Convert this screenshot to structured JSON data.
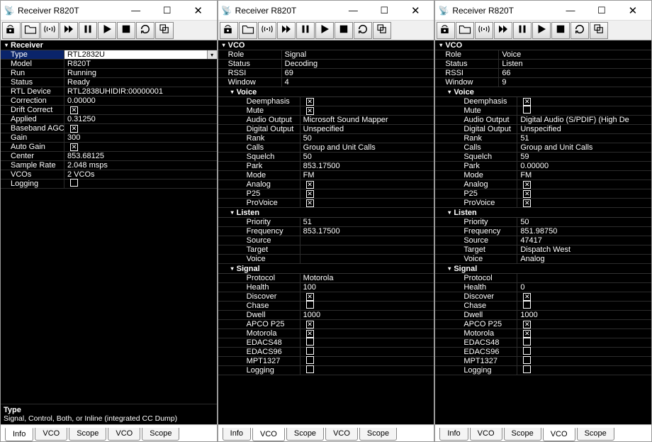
{
  "common": {
    "window_title": "Receiver R820T",
    "toolbar_icons": [
      "device",
      "open",
      "broadcast",
      "fast-forward",
      "pause",
      "play",
      "stop",
      "loop",
      "copy"
    ],
    "tabs": [
      "Info",
      "VCO",
      "Scope",
      "VCO",
      "Scope"
    ]
  },
  "win1": {
    "active_tab": 0,
    "sections": {
      "Receiver": {
        "rows": [
          {
            "label": "Type",
            "value": "RTL2832U",
            "selected": true,
            "dropdown": true
          },
          {
            "label": "Model",
            "value": "R820T"
          },
          {
            "label": "Run",
            "value": "Running"
          },
          {
            "label": "Status",
            "value": "Ready"
          },
          {
            "label": "RTL Device",
            "value": "RTL2838UHIDIR:00000001"
          },
          {
            "label": "Correction",
            "value": "0.00000"
          },
          {
            "label": "Drift Correct",
            "checkbox": true,
            "checked": true
          },
          {
            "label": "Applied",
            "value": "0.31250"
          },
          {
            "label": "Baseband AGC",
            "checkbox": true,
            "checked": true
          },
          {
            "label": "Gain",
            "value": "300"
          },
          {
            "label": "Auto Gain",
            "checkbox": true,
            "checked": true
          },
          {
            "label": "Center",
            "value": "853.68125"
          },
          {
            "label": "Sample Rate",
            "value": "2.048 msps"
          },
          {
            "label": "VCOs",
            "value": "2 VCOs"
          },
          {
            "label": "Logging",
            "checkbox": true,
            "checked": false
          }
        ]
      }
    },
    "desc_title": "Type",
    "desc_text": "Signal, Control, Both, or Inline (integrated CC Dump)"
  },
  "win2": {
    "active_tab": 1,
    "groups": [
      {
        "header": "VCO",
        "indent": false,
        "rows": [
          {
            "label": "Role",
            "value": "Signal"
          },
          {
            "label": "Status",
            "value": "Decoding"
          },
          {
            "label": "RSSI",
            "value": "69"
          },
          {
            "label": "Window",
            "value": "4"
          }
        ]
      },
      {
        "header": "Voice",
        "indent": true,
        "rows": [
          {
            "label": "Deemphasis",
            "checkbox": true,
            "checked": true
          },
          {
            "label": "Mute",
            "checkbox": true,
            "checked": true
          },
          {
            "label": "Audio Output",
            "value": "Microsoft Sound Mapper"
          },
          {
            "label": "Digital Output",
            "value": "Unspecified"
          },
          {
            "label": "Rank",
            "value": "50"
          },
          {
            "label": "Calls",
            "value": "Group and Unit Calls"
          },
          {
            "label": "Squelch",
            "value": "50"
          },
          {
            "label": "Park",
            "value": "853.17500"
          },
          {
            "label": "Mode",
            "value": "FM"
          },
          {
            "label": "Analog",
            "checkbox": true,
            "checked": true
          },
          {
            "label": "P25",
            "checkbox": true,
            "checked": true
          },
          {
            "label": "ProVoice",
            "checkbox": true,
            "checked": true
          }
        ]
      },
      {
        "header": "Listen",
        "indent": true,
        "rows": [
          {
            "label": "Priority",
            "value": "51"
          },
          {
            "label": "Frequency",
            "value": "853.17500"
          },
          {
            "label": "Source",
            "value": ""
          },
          {
            "label": "Target",
            "value": ""
          },
          {
            "label": "Voice",
            "value": ""
          }
        ]
      },
      {
        "header": "Signal",
        "indent": true,
        "rows": [
          {
            "label": "Protocol",
            "value": "Motorola"
          },
          {
            "label": "Health",
            "value": "100"
          },
          {
            "label": "Discover",
            "checkbox": true,
            "checked": true
          },
          {
            "label": "Chase",
            "checkbox": true,
            "checked": false
          },
          {
            "label": "Dwell",
            "value": "1000"
          },
          {
            "label": "APCO P25",
            "checkbox": true,
            "checked": true
          },
          {
            "label": "Motorola",
            "checkbox": true,
            "checked": true
          },
          {
            "label": "EDACS48",
            "checkbox": true,
            "checked": false
          },
          {
            "label": "EDACS96",
            "checkbox": true,
            "checked": false
          },
          {
            "label": "MPT1327",
            "checkbox": true,
            "checked": false
          },
          {
            "label": "Logging",
            "checkbox": true,
            "checked": false
          }
        ]
      }
    ]
  },
  "win3": {
    "active_tab": 3,
    "groups": [
      {
        "header": "VCO",
        "indent": false,
        "rows": [
          {
            "label": "Role",
            "value": "Voice"
          },
          {
            "label": "Status",
            "value": "Listen"
          },
          {
            "label": "RSSI",
            "value": "66"
          },
          {
            "label": "Window",
            "value": "9"
          }
        ]
      },
      {
        "header": "Voice",
        "indent": true,
        "rows": [
          {
            "label": "Deemphasis",
            "checkbox": true,
            "checked": true
          },
          {
            "label": "Mute",
            "checkbox": true,
            "checked": false
          },
          {
            "label": "Audio Output",
            "value": "Digital Audio (S/PDIF) (High De"
          },
          {
            "label": "Digital Output",
            "value": "Unspecified"
          },
          {
            "label": "Rank",
            "value": "51"
          },
          {
            "label": "Calls",
            "value": "Group and Unit Calls"
          },
          {
            "label": "Squelch",
            "value": "59"
          },
          {
            "label": "Park",
            "value": "0.00000"
          },
          {
            "label": "Mode",
            "value": "FM"
          },
          {
            "label": "Analog",
            "checkbox": true,
            "checked": true
          },
          {
            "label": "P25",
            "checkbox": true,
            "checked": true
          },
          {
            "label": "ProVoice",
            "checkbox": true,
            "checked": true
          }
        ]
      },
      {
        "header": "Listen",
        "indent": true,
        "rows": [
          {
            "label": "Priority",
            "value": "50"
          },
          {
            "label": "Frequency",
            "value": "851.98750"
          },
          {
            "label": "Source",
            "value": "47417"
          },
          {
            "label": "Target",
            "value": "Dispatch West"
          },
          {
            "label": "Voice",
            "value": "Analog"
          }
        ]
      },
      {
        "header": "Signal",
        "indent": true,
        "rows": [
          {
            "label": "Protocol",
            "value": ""
          },
          {
            "label": "Health",
            "value": "0"
          },
          {
            "label": "Discover",
            "checkbox": true,
            "checked": true
          },
          {
            "label": "Chase",
            "checkbox": true,
            "checked": false
          },
          {
            "label": "Dwell",
            "value": "1000"
          },
          {
            "label": "APCO P25",
            "checkbox": true,
            "checked": true
          },
          {
            "label": "Motorola",
            "checkbox": true,
            "checked": true
          },
          {
            "label": "EDACS48",
            "checkbox": true,
            "checked": false
          },
          {
            "label": "EDACS96",
            "checkbox": true,
            "checked": false
          },
          {
            "label": "MPT1327",
            "checkbox": true,
            "checked": false
          },
          {
            "label": "Logging",
            "checkbox": true,
            "checked": false
          }
        ]
      }
    ]
  }
}
